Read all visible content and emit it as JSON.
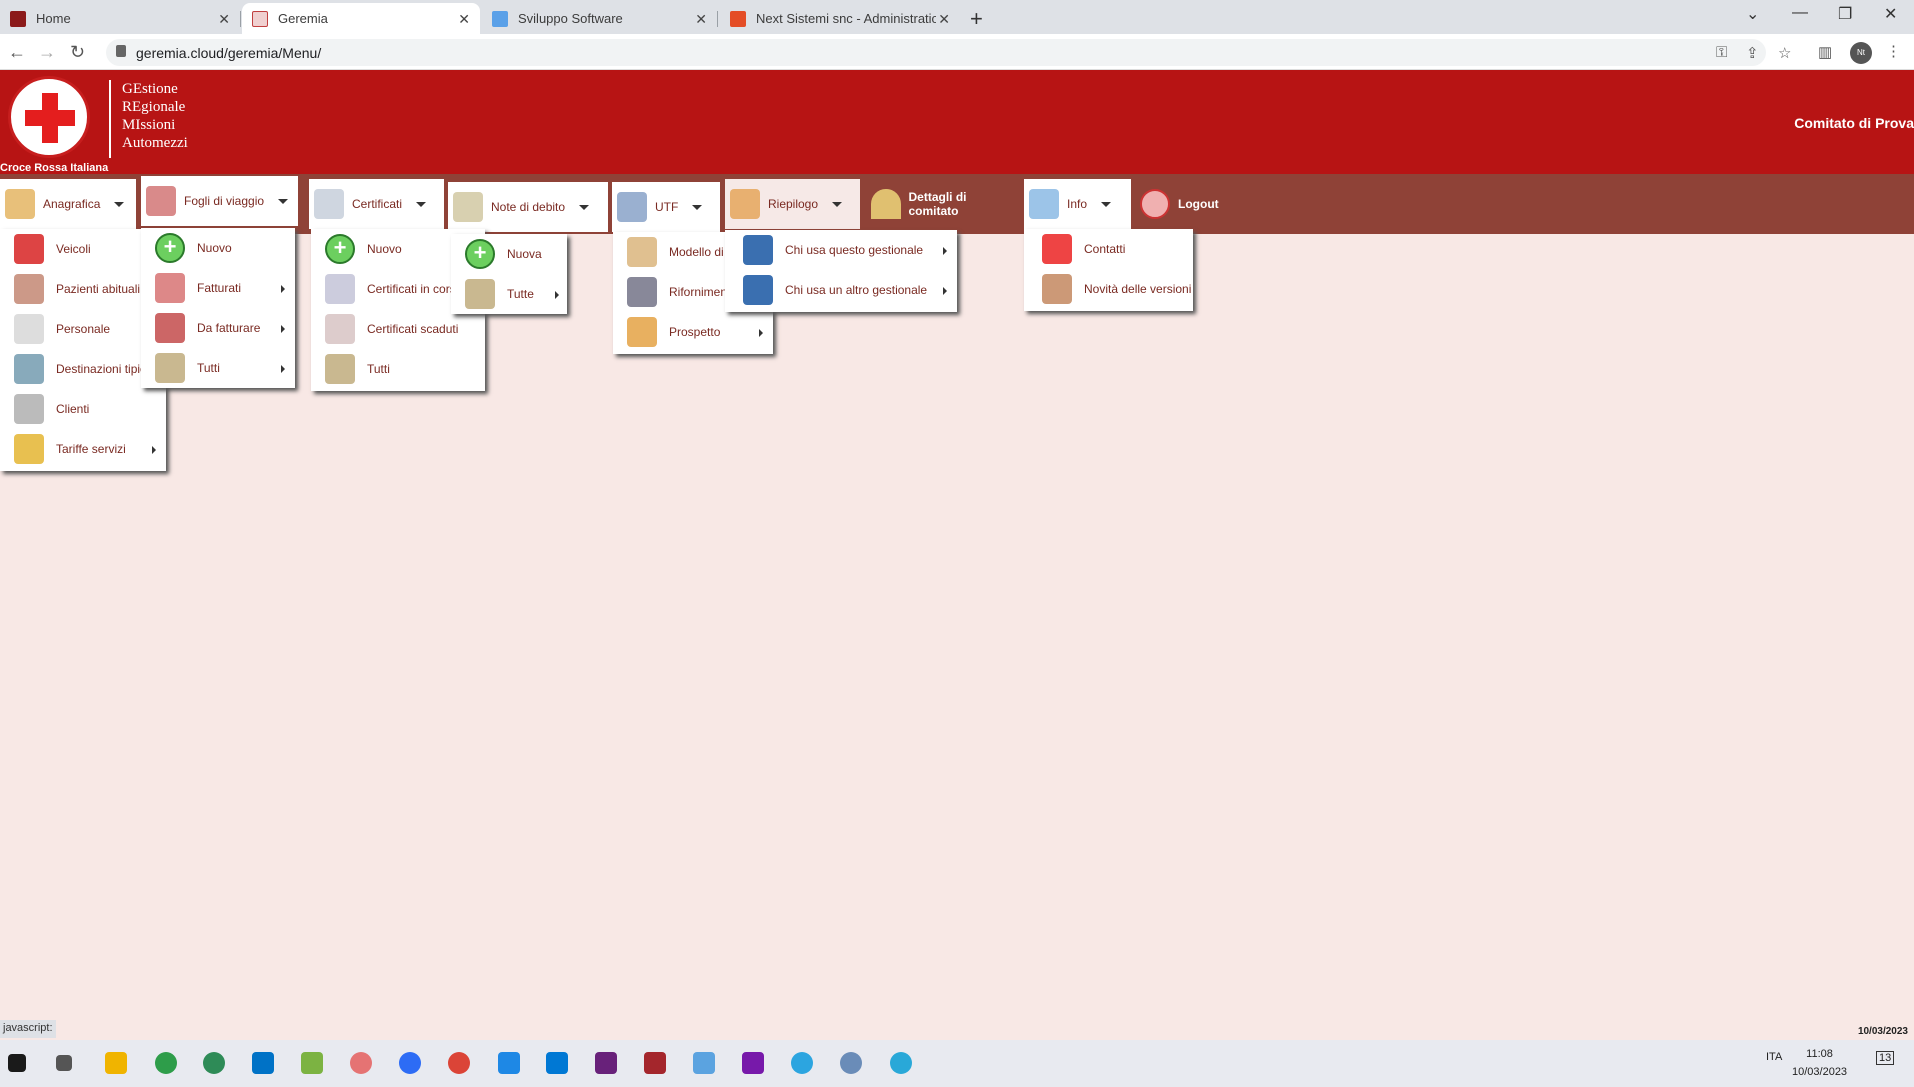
{
  "browser": {
    "tabs": [
      {
        "label": "Home",
        "color": "#8b1a1a"
      },
      {
        "label": "Geremia",
        "color": "#c04040"
      },
      {
        "label": "Sviluppo Software",
        "color": "#1a73e8"
      },
      {
        "label": "Next Sistemi snc - Administration",
        "color": "#e44d26"
      }
    ],
    "url": "geremia.cloud/geremia/Menu/",
    "avatar_text": "Nt"
  },
  "header": {
    "logo_lines": [
      "GEstione",
      "REgionale",
      "MIssioni",
      "Automezzi"
    ],
    "logo_caption": "Croce Rossa Italiana",
    "committee": "Comitato di Prova",
    "brand_color": "#b71414"
  },
  "menu": {
    "anagrafica": "Anagrafica",
    "fogli": "Fogli di viaggio",
    "certificati": "Certificati",
    "note": "Note di debito",
    "utf": "UTF",
    "riepilogo": "Riepilogo",
    "dettagli": "Dettagli di comitato",
    "info": "Info",
    "logout": "Logout"
  },
  "dropdowns": {
    "anagrafica": [
      "Veicoli",
      "Pazienti abituali",
      "Personale",
      "Destinazioni tipiche",
      "Clienti",
      "Tariffe servizi"
    ],
    "fogli": [
      "Nuovo",
      "Fatturati",
      "Da fatturare",
      "Tutti"
    ],
    "certificati": [
      "Nuovo",
      "Certificati in corso",
      "Certificati scaduti",
      "Tutti"
    ],
    "note": [
      "Nuova",
      "Tutte"
    ],
    "utf": [
      "Modello di",
      "Rifornimenti",
      "Prospetto"
    ],
    "riepilogo": [
      "Chi usa questo gestionale",
      "Chi usa un altro gestionale"
    ],
    "info": [
      "Contatti",
      "Novità delle versioni"
    ]
  },
  "status": {
    "bar_text": "javascript:",
    "date_top": "10/03/2023",
    "time": "11:08",
    "date": "10/03/2023",
    "lang": "ITA",
    "notif": "13"
  }
}
